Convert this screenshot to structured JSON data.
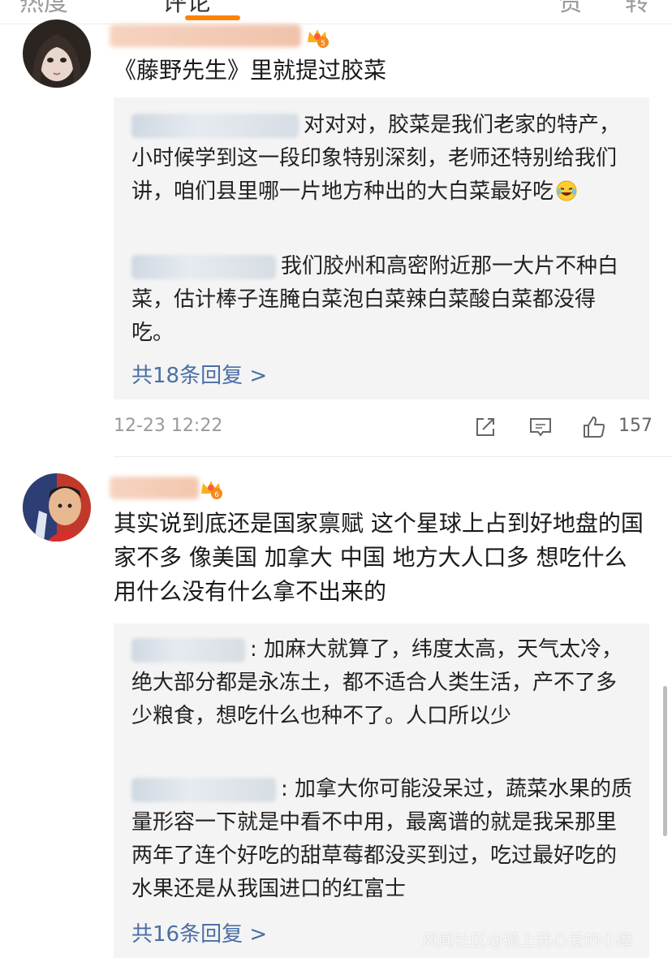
{
  "top_tabs": [
    "热度",
    "评论",
    "赞",
    "转"
  ],
  "comments": [
    {
      "text": "《藤野先生》里就提过胶菜",
      "level_badge": "5",
      "replies": [
        {
          "text": "对对对，胶菜是我们老家的特产，小时候学到这一段印象特别深刻，老师还特别给我们讲，咱们县里哪一片地方种出的大白菜最好吃"
        },
        {
          "text": "我们胶州和高密附近那一大片不种白菜，估计棒子连腌白菜泡白菜辣白菜酸白菜都没得吃。"
        }
      ],
      "more_replies": "共18条回复 >",
      "timestamp": "12-23 12:22",
      "like_count": "157"
    },
    {
      "text": "其实说到底还是国家禀赋 这个星球上占到好地盘的国家不多 像美国 加拿大 中国 地方大人口多 想吃什么用什么没有什么拿不出来的",
      "level_badge": "6",
      "replies": [
        {
          "text": ": 加麻大就算了，纬度太高，天气太冷，绝大部分都是永冻土，都不适合人类生活，产不了多少粮食，想吃什么也种不了。人口所以少"
        },
        {
          "text": ": 加拿大你可能没呆过，蔬菜水果的质量形容一下就是中看不中用，最离谱的就是我呆那里两年了连个好吃的甜草莓都没买到过，吃过最好吃的水果还是从我国进口的红富士"
        }
      ],
      "more_replies": "共16条回复 >"
    }
  ],
  "watermark": "风闻社区@骑上我心爱的小摩",
  "colors": {
    "accent": "#ff8200",
    "link": "#4a6fa5",
    "reply_bg": "#f4f4f4"
  },
  "icons": [
    "share-icon",
    "comment-icon",
    "like-icon",
    "vip-crown-icon"
  ]
}
